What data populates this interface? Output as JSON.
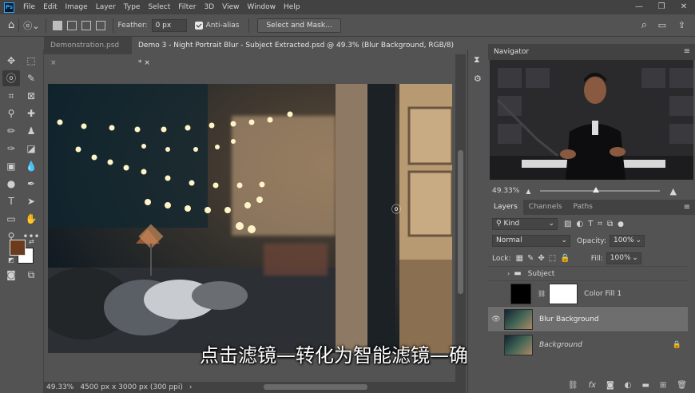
{
  "menubar": {
    "logo": "Ps",
    "items": [
      "File",
      "Edit",
      "Image",
      "Layer",
      "Type",
      "Select",
      "Filter",
      "3D",
      "View",
      "Window",
      "Help"
    ],
    "window_controls": [
      "—",
      "❐",
      "✕"
    ]
  },
  "options": {
    "feather_label": "Feather:",
    "feather_value": "0 px",
    "antialias_label": "Anti-alias",
    "antialias_checked": true,
    "select_mask": "Select and Mask..."
  },
  "tabs": [
    {
      "label": "Demonstration.psd",
      "close": "×"
    },
    {
      "label": "Demo 3 - Night Portrait Blur - Subject Extracted.psd @ 49.3% (Blur Background, RGB/8) *",
      "close": "×"
    }
  ],
  "status": {
    "zoom": "49.33%",
    "info": "4500 px x 3000 px (300 ppi)"
  },
  "subtitle": "点击滤镜—转化为智能滤镜—确定",
  "navigator": {
    "title": "Navigator",
    "zoom": "49.33%"
  },
  "layers_panel": {
    "tabs": [
      "Layers",
      "Channels",
      "Paths"
    ],
    "filter_kind": "Kind",
    "blend_mode": "Normal",
    "opacity_label": "Opacity:",
    "opacity_value": "100%",
    "lock_label": "Lock:",
    "fill_label": "Fill:",
    "fill_value": "100%",
    "layers": [
      {
        "name": "Subject",
        "type": "group",
        "visible": false
      },
      {
        "name": "Color Fill 1",
        "type": "fill",
        "visible": false
      },
      {
        "name": "Blur Background",
        "type": "smart",
        "visible": true,
        "selected": true
      },
      {
        "name": "Background",
        "type": "locked",
        "visible": false
      }
    ]
  },
  "colors": {
    "foreground": "#6a3b1c",
    "background": "#ffffff",
    "accent": "#31a8ff"
  }
}
